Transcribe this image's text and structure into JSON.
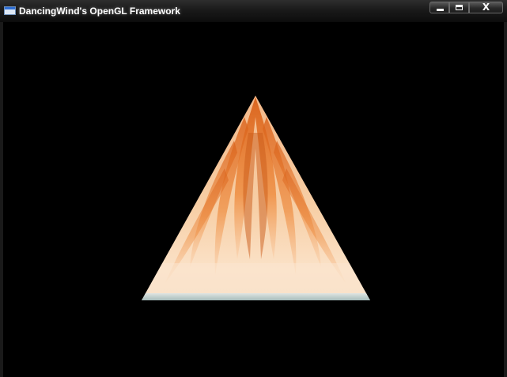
{
  "window": {
    "title": "DancingWind's OpenGL Framework",
    "icon": "application-window-icon",
    "controls": {
      "minimize_icon": "minimize-icon",
      "maximize_icon": "maximize-icon",
      "close_label": "X"
    }
  },
  "viewport": {
    "background_color": "#000000",
    "object": "textured-triangle",
    "texture_colors": [
      "#f2c9a0",
      "#e87a2a",
      "#fbe3c6",
      "#c7d6d3"
    ]
  }
}
